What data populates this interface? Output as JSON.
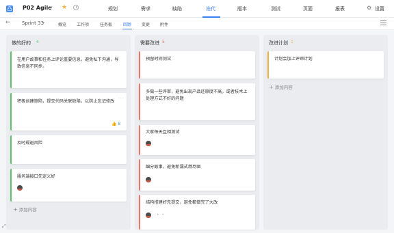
{
  "project": {
    "icon_letter": "凸",
    "name": "P02 Agile",
    "caret": "▾"
  },
  "nav": {
    "tabs": [
      "规划",
      "需求",
      "缺陷",
      "迭代",
      "版本",
      "测试",
      "页面",
      "报表"
    ],
    "active_index": 3,
    "settings_label": "设置"
  },
  "subnav": {
    "sprint": "Sprint 33",
    "tabs": [
      "概览",
      "工作项",
      "任务板",
      "回顾",
      "变更",
      "附件"
    ],
    "active_index": 3
  },
  "columns": [
    {
      "title": "做的好的",
      "count": "4",
      "accent": "#5cc36b",
      "add_label": "添加内容",
      "cards": [
        {
          "text": "在用户故事和任务上评论重要信息，避免私下沟通，导致信息不同步。"
        },
        {
          "text": "积极创建缺陷，提交代码关联缺陷，以防止忘记修改",
          "likes": "8"
        },
        {
          "text": "及时规避风险"
        },
        {
          "text": "服务端接口先定义好"
        }
      ]
    },
    {
      "title": "需要改进",
      "count": "5",
      "accent": "#e9786b",
      "add_label": "",
      "cards": [
        {
          "text": "预留时间测试"
        },
        {
          "text": "多做一些评审，避免出现产品还原度不高，或者技术上处理方式不好的问题"
        },
        {
          "text": "大家每天互相测试"
        },
        {
          "text": "细分故事，避免新漏式燃尽图"
        },
        {
          "text": "结构搭建好先提交，避免都做完了大改"
        }
      ]
    },
    {
      "title": "改进计划",
      "count": "1",
      "accent": "#f0b23e",
      "add_label": "添加内容",
      "cards": [
        {
          "text": "计划会加上评审计划"
        }
      ]
    }
  ]
}
